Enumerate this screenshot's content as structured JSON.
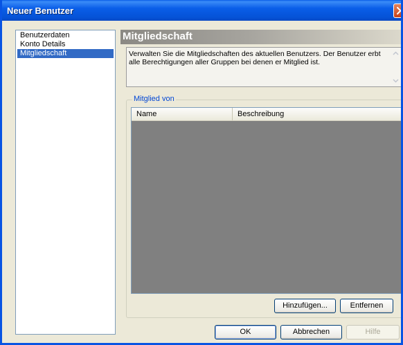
{
  "window": {
    "title": "Neuer Benutzer"
  },
  "nav": {
    "items": [
      {
        "label": "Benutzerdaten"
      },
      {
        "label": "Konto Details"
      },
      {
        "label": "Mitgliedschaft"
      }
    ],
    "selected": "Mitgliedschaft"
  },
  "section": {
    "title": "Mitgliedschaft"
  },
  "description": {
    "line1": "Verwalten Sie die Mitgliedschaften des aktuellen Benutzers. Der Benutzer erbt",
    "line2": "alle Berechtigungen aller Gruppen bei denen er Mitglied ist."
  },
  "group": {
    "label": "Mitglied von"
  },
  "table": {
    "columns": [
      "Name",
      "Beschreibung"
    ],
    "rows": []
  },
  "buttons": {
    "add": "Hinzufügen...",
    "remove": "Entfernen",
    "ok": "OK",
    "cancel": "Abbrechen",
    "help": "Hilfe"
  },
  "colors": {
    "titlebar": "#0a5ee8",
    "selection": "#316ac5",
    "group_label": "#0046d5",
    "list_background": "#808080"
  }
}
